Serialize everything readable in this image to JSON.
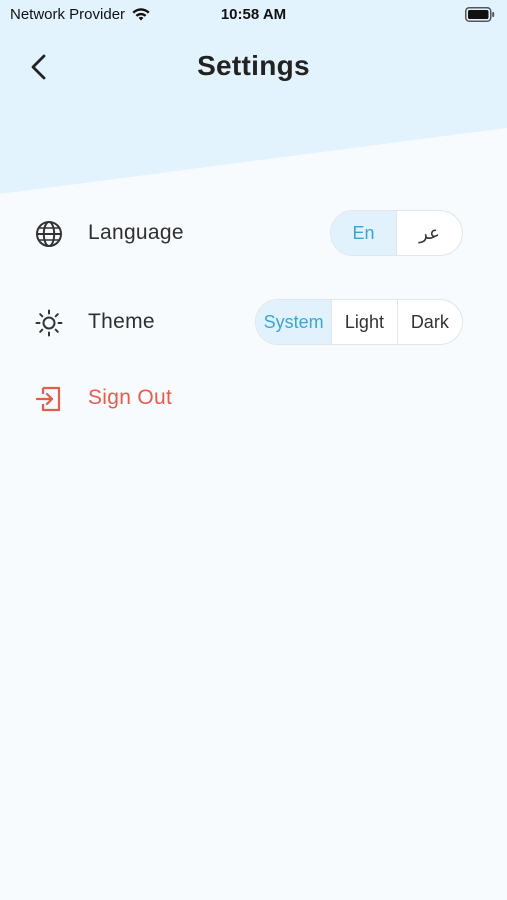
{
  "status_bar": {
    "carrier": "Network Provider",
    "time": "10:58 AM"
  },
  "header": {
    "title": "Settings",
    "back_icon": "chevron-left-icon"
  },
  "settings": {
    "language": {
      "label": "Language",
      "icon": "globe-icon",
      "options": [
        "En",
        "عر"
      ],
      "selected": "En"
    },
    "theme": {
      "label": "Theme",
      "icon": "sun-icon",
      "options": [
        "System",
        "Light",
        "Dark"
      ],
      "selected": "System"
    },
    "sign_out": {
      "label": "Sign Out",
      "icon": "sign-out-icon"
    }
  },
  "colors": {
    "accent": "#3aa6d6",
    "accent_bg": "#e1f2fd",
    "header_bg": "#e3f3fd",
    "danger": "#e25d4c",
    "page_bg": "#f8fbfe"
  }
}
